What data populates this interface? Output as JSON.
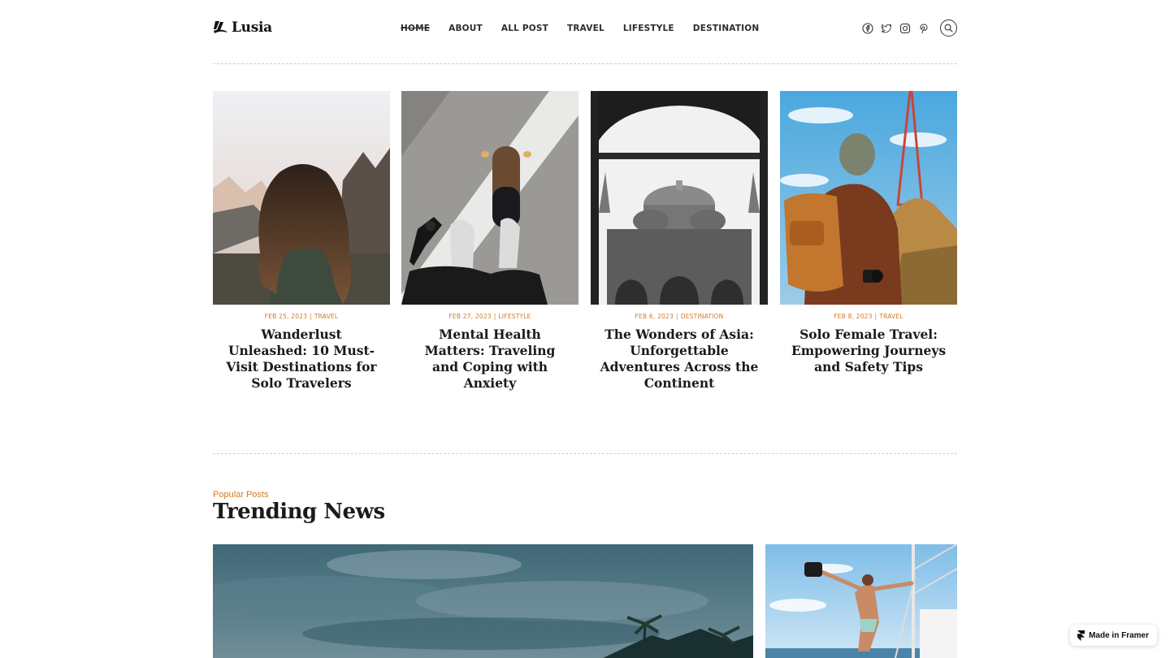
{
  "brand": {
    "name": "Lusia"
  },
  "nav": [
    {
      "label": "HOME",
      "active": true
    },
    {
      "label": "ABOUT"
    },
    {
      "label": "ALL POST"
    },
    {
      "label": "TRAVEL"
    },
    {
      "label": "LIFESTYLE"
    },
    {
      "label": "DESTINATION"
    }
  ],
  "socials": [
    "facebook-icon",
    "twitter-icon",
    "instagram-icon",
    "pinterest-icon"
  ],
  "cards": [
    {
      "date": "FEB 25, 2023",
      "category": "TRAVEL",
      "title": "Wanderlust Unleashed: 10 Must-Visit Destinations for Solo Travelers",
      "image": "woman-long-hair-mountains"
    },
    {
      "date": "FEB 27, 2023",
      "category": "LIFESTYLE",
      "title": "Mental Health Matters: Traveling and Coping with Anxiety",
      "image": "skateboard-feet-camera"
    },
    {
      "date": "FEB 6, 2023",
      "category": "DESTINATION",
      "title": "The Wonders of Asia: Unforgettable Adventures Across the Continent",
      "image": "mosque-black-white"
    },
    {
      "date": "FEB 8, 2023",
      "category": "TRAVEL",
      "title": "Solo Female Travel: Empowering Journeys and Safety Tips",
      "image": "backpacker-eiffel-tower"
    }
  ],
  "section": {
    "kicker": "Popular Posts",
    "heading": "Trending News"
  },
  "featured": [
    {
      "image": "stormy-sky-palm-trees"
    },
    {
      "image": "man-on-sailboat"
    }
  ],
  "badge": {
    "label": "Made in Framer"
  },
  "colors": {
    "accent": "#d07a2a",
    "text": "#1a1a1a"
  }
}
